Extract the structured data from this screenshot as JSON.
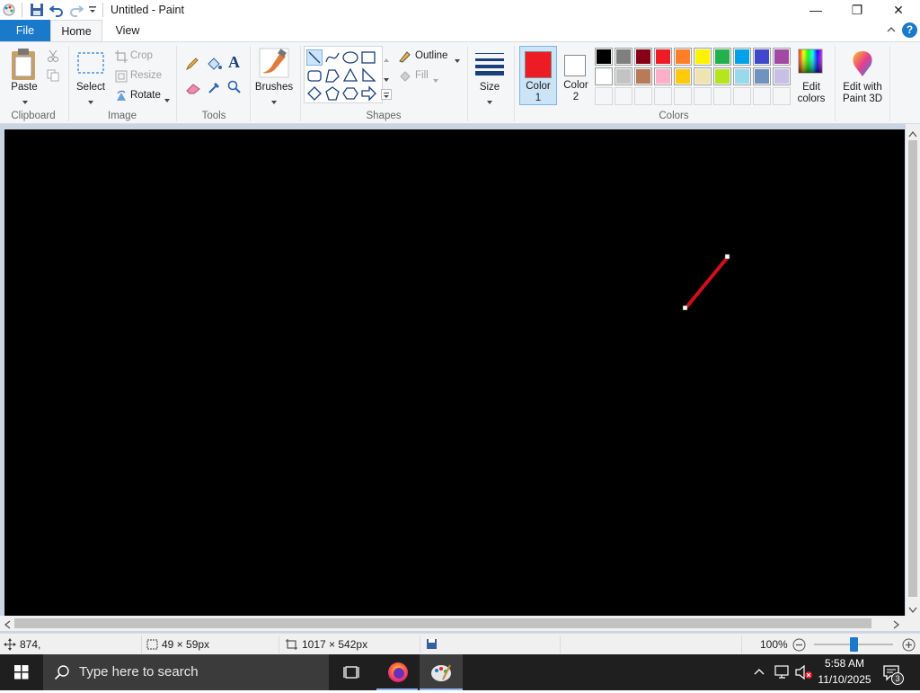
{
  "window": {
    "title": "Untitled - Paint",
    "minimize_glyph": "—",
    "maximize_glyph": "❐",
    "close_glyph": "✕"
  },
  "tabs": {
    "file": "File",
    "home": "Home",
    "view": "View"
  },
  "help_glyph": "?",
  "ribbon": {
    "clipboard": {
      "paste": "Paste",
      "label": "Clipboard"
    },
    "image": {
      "select": "Select",
      "crop": "Crop",
      "resize": "Resize",
      "rotate": "Rotate",
      "label": "Image"
    },
    "tools": {
      "label": "Tools",
      "text_glyph": "A"
    },
    "brushes": {
      "label": "Brushes"
    },
    "shapes": {
      "outline": "Outline",
      "fill": "Fill",
      "label": "Shapes"
    },
    "size": {
      "label": "Size"
    },
    "colors": {
      "color1_label": "Color",
      "color1_num": "1",
      "color2_label": "Color",
      "color2_num": "2",
      "color1": "#ed1c24",
      "color2": "#ffffff",
      "edit_colors_1": "Edit",
      "edit_colors_2": "colors",
      "label": "Colors",
      "palette_row1": [
        "#000000",
        "#7f7f7f",
        "#880015",
        "#ed1c24",
        "#ff7f27",
        "#fff200",
        "#22b14c",
        "#00a2e8",
        "#3f48cc",
        "#a349a4"
      ],
      "palette_row2": [
        "#ffffff",
        "#c3c3c3",
        "#b97a57",
        "#ffaec9",
        "#ffc90e",
        "#efe4b0",
        "#b5e61d",
        "#99d9ea",
        "#7092be",
        "#c8bfe7"
      ]
    },
    "paint3d": {
      "line1": "Edit with",
      "line2": "Paint 3D"
    }
  },
  "canvas": {
    "background": "#000000",
    "stroke_color": "#d0101c"
  },
  "status": {
    "cursor_pos": "874,",
    "selection_size": "49 × 59px",
    "canvas_size": "1017 × 542px",
    "zoom": "100%"
  },
  "taskbar": {
    "search_placeholder": "Type here to search",
    "time": "5:58 AM",
    "date": "11/10/2025",
    "notification_count": "3"
  }
}
